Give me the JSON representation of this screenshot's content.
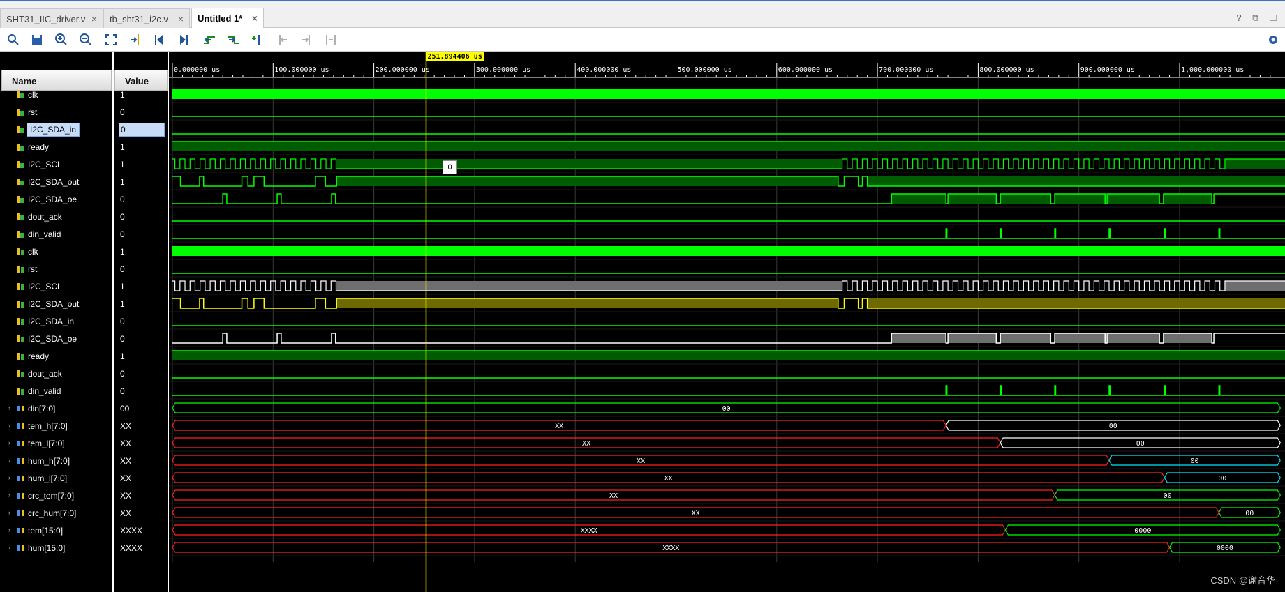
{
  "tabs": [
    {
      "label": "SHT31_IIC_driver.v",
      "active": false
    },
    {
      "label": "tb_sht31_i2c.v",
      "active": false
    },
    {
      "label": "Untitled 1*",
      "active": true
    }
  ],
  "tabbar_right": "? ⧉ ☐",
  "toolbar_icons": [
    "search-icon",
    "save-icon",
    "zoom-in-icon",
    "zoom-out-icon",
    "zoom-fit-icon",
    "go-to-cursor-icon",
    "go-to-start-icon",
    "go-to-end-icon",
    "previous-transition-icon",
    "next-transition-icon",
    "add-marker-icon",
    "previous-marker-icon",
    "next-marker-icon",
    "swap-cursors-icon",
    "settings-icon"
  ],
  "headers": {
    "name": "Name",
    "value": "Value"
  },
  "cursor": {
    "time_label": "251.894406 us",
    "time_us": 251.894406
  },
  "tooltip": "0",
  "timeline": {
    "range_us": [
      0,
      1100
    ],
    "ticks": [
      "0.000000 us",
      "100.000000 us",
      "200.000000 us",
      "300.000000 us",
      "400.000000 us",
      "500.000000 us",
      "600.000000 us",
      "700.000000 us",
      "800.000000 us",
      "900.000000 us",
      "1,000.000000 us"
    ],
    "tick_values_us": [
      0,
      100,
      200,
      300,
      400,
      500,
      600,
      700,
      800,
      900,
      1000
    ]
  },
  "signals": [
    {
      "name": "clk",
      "value": "1",
      "kind": "bit",
      "icon": "input",
      "wave": "clk",
      "color": "#00ff00"
    },
    {
      "name": "rst",
      "value": "0",
      "kind": "bit",
      "icon": "input",
      "wave": "low",
      "color": "#00ff00"
    },
    {
      "name": "I2C_SDA_in",
      "value": "0",
      "kind": "bit",
      "icon": "input",
      "wave": "low",
      "color": "#00ff00",
      "selected": true
    },
    {
      "name": "ready",
      "value": "1",
      "kind": "bit",
      "icon": "input",
      "wave": "high",
      "color": "#00ff00"
    },
    {
      "name": "I2C_SCL",
      "value": "1",
      "kind": "bit",
      "icon": "input",
      "wave": "scl",
      "color": "#00ff00"
    },
    {
      "name": "I2C_SDA_out",
      "value": "1",
      "kind": "bit",
      "icon": "input",
      "wave": "sda_out",
      "color": "#00ff00"
    },
    {
      "name": "I2C_SDA_oe",
      "value": "0",
      "kind": "bit",
      "icon": "input",
      "wave": "sda_oe",
      "color": "#00ff00"
    },
    {
      "name": "dout_ack",
      "value": "0",
      "kind": "bit",
      "icon": "input",
      "wave": "low",
      "color": "#00ff00"
    },
    {
      "name": "din_valid",
      "value": "0",
      "kind": "bit",
      "icon": "input",
      "wave": "pulses",
      "color": "#00ff00"
    },
    {
      "name": "clk",
      "value": "1",
      "kind": "bit",
      "icon": "internal",
      "wave": "clk",
      "color": "#00ff00"
    },
    {
      "name": "rst",
      "value": "0",
      "kind": "bit",
      "icon": "internal",
      "wave": "low",
      "color": "#00ff00"
    },
    {
      "name": "I2C_SCL",
      "value": "1",
      "kind": "bit",
      "icon": "internal",
      "wave": "scl",
      "color": "#ffffff",
      "z_color": "#6e6e6e"
    },
    {
      "name": "I2C_SDA_out",
      "value": "1",
      "kind": "bit",
      "icon": "internal",
      "wave": "sda_out",
      "color": "#ffff00",
      "z_color": "#6e6a00"
    },
    {
      "name": "I2C_SDA_in",
      "value": "0",
      "kind": "bit",
      "icon": "internal",
      "wave": "low",
      "color": "#00ff00"
    },
    {
      "name": "I2C_SDA_oe",
      "value": "0",
      "kind": "bit",
      "icon": "internal",
      "wave": "sda_oe",
      "color": "#ffffff",
      "z_color": "#6e6e6e"
    },
    {
      "name": "ready",
      "value": "1",
      "kind": "bit",
      "icon": "internal",
      "wave": "high",
      "color": "#00ff00"
    },
    {
      "name": "dout_ack",
      "value": "0",
      "kind": "bit",
      "icon": "internal",
      "wave": "low",
      "color": "#00ff00"
    },
    {
      "name": "din_valid",
      "value": "0",
      "kind": "bit",
      "icon": "internal",
      "wave": "pulses",
      "color": "#00ff00"
    },
    {
      "name": "din[7:0]",
      "value": "00",
      "kind": "bus",
      "segments": [
        {
          "start": 0,
          "end": 1100,
          "text": "00",
          "color": "#00ff00"
        }
      ]
    },
    {
      "name": "tem_h[7:0]",
      "value": "XX",
      "kind": "bus",
      "segments": [
        {
          "start": 0,
          "end": 768,
          "text": "XX",
          "color": "#ff2020"
        },
        {
          "start": 768,
          "end": 1100,
          "text": "00",
          "color": "#ffffff"
        }
      ]
    },
    {
      "name": "tem_l[7:0]",
      "value": "XX",
      "kind": "bus",
      "segments": [
        {
          "start": 0,
          "end": 822,
          "text": "XX",
          "color": "#ff2020"
        },
        {
          "start": 822,
          "end": 1100,
          "text": "00",
          "color": "#ffffff"
        }
      ]
    },
    {
      "name": "hum_h[7:0]",
      "value": "XX",
      "kind": "bus",
      "segments": [
        {
          "start": 0,
          "end": 930,
          "text": "XX",
          "color": "#ff2020"
        },
        {
          "start": 930,
          "end": 1100,
          "text": "00",
          "color": "#00e5ff"
        }
      ]
    },
    {
      "name": "hum_l[7:0]",
      "value": "XX",
      "kind": "bus",
      "segments": [
        {
          "start": 0,
          "end": 985,
          "text": "XX",
          "color": "#ff2020"
        },
        {
          "start": 985,
          "end": 1100,
          "text": "00",
          "color": "#00e5ff"
        }
      ]
    },
    {
      "name": "crc_tem[7:0]",
      "value": "XX",
      "kind": "bus",
      "segments": [
        {
          "start": 0,
          "end": 876,
          "text": "XX",
          "color": "#ff2020"
        },
        {
          "start": 876,
          "end": 1100,
          "text": "00",
          "color": "#00ff00"
        }
      ]
    },
    {
      "name": "crc_hum[7:0]",
      "value": "XX",
      "kind": "bus",
      "segments": [
        {
          "start": 0,
          "end": 1039,
          "text": "XX",
          "color": "#ff2020"
        },
        {
          "start": 1039,
          "end": 1100,
          "text": "00",
          "color": "#00ff00"
        }
      ]
    },
    {
      "name": "tem[15:0]",
      "value": "XXXX",
      "kind": "bus",
      "segments": [
        {
          "start": 0,
          "end": 827,
          "text": "XXXX",
          "color": "#ff2020"
        },
        {
          "start": 827,
          "end": 1100,
          "text": "0000",
          "color": "#00ff00"
        }
      ]
    },
    {
      "name": "hum[15:0]",
      "value": "XXXX",
      "kind": "bus",
      "segments": [
        {
          "start": 0,
          "end": 990,
          "text": "XXXX",
          "color": "#ff2020"
        },
        {
          "start": 990,
          "end": 1100,
          "text": "0000",
          "color": "#00ff00"
        }
      ]
    }
  ],
  "watermark": "CSDN @谢音华"
}
